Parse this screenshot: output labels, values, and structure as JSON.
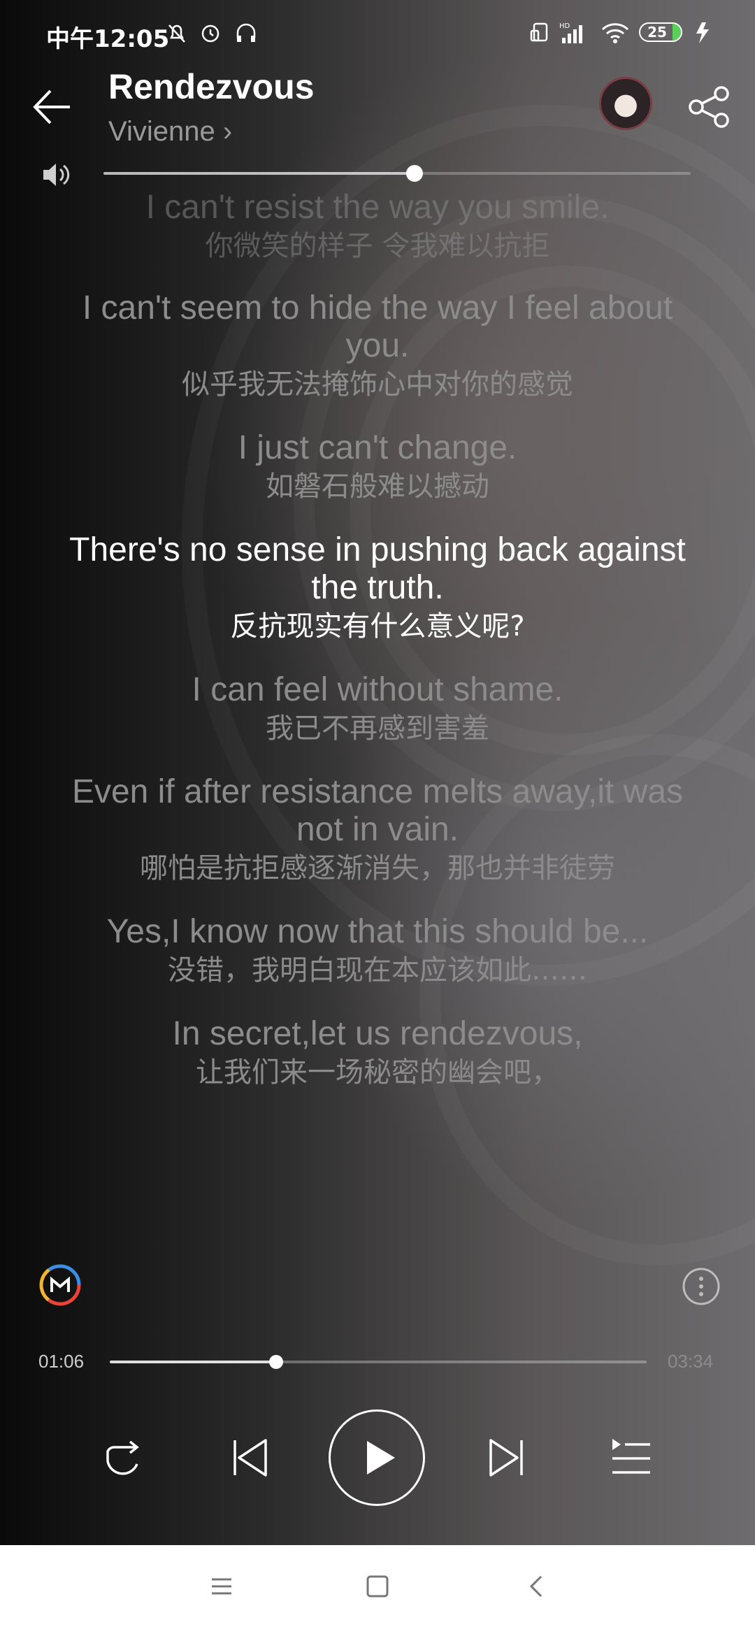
{
  "status_bar": {
    "time": "中午12:05",
    "battery": "25",
    "network": "HD"
  },
  "header": {
    "title": "Rendezvous",
    "artist": "Vivienne",
    "artist_chevron": "›"
  },
  "volume": {
    "level": 0.53
  },
  "lyrics": [
    {
      "en": "I can't resist the way you smile.",
      "zh": "你微笑的样子 令我难以抗拒",
      "state": "faded"
    },
    {
      "en": "I can't seem to hide the way I feel about you.",
      "zh": "似乎我无法掩饰心中对你的感觉",
      "state": "normal"
    },
    {
      "en": "I just can't change.",
      "zh": "如磐石般难以撼动",
      "state": "normal"
    },
    {
      "en": "There's no sense in pushing back against the truth.",
      "zh": "反抗现实有什么意义呢?",
      "state": "active"
    },
    {
      "en": "I can feel without shame.",
      "zh": "我已不再感到害羞",
      "state": "normal"
    },
    {
      "en": "Even if after resistance melts away,it was not in vain.",
      "zh": "哪怕是抗拒感逐渐消失，那也并非徒劳",
      "state": "normal"
    },
    {
      "en": "Yes,I know now that this should be...",
      "zh": "没错，我明白现在本应该如此……",
      "state": "normal"
    },
    {
      "en": "In secret,let us rendezvous,",
      "zh": "让我们来一场秘密的幽会吧，",
      "state": "normal"
    }
  ],
  "player": {
    "current_time": "01:06",
    "total_time": "03:34",
    "progress": 0.31,
    "state": "paused"
  },
  "icons": {
    "back": "back-arrow-icon",
    "share": "share-icon",
    "volume": "speaker-icon",
    "repeat": "repeat-icon",
    "previous": "previous-icon",
    "play": "play-icon",
    "next": "next-icon",
    "playlist": "playlist-icon",
    "more": "more-vertical-icon",
    "logo": "m-logo-icon"
  },
  "colors": {
    "active_lyric": "#ffffff",
    "inactive_lyric": "#8c8c8c"
  }
}
